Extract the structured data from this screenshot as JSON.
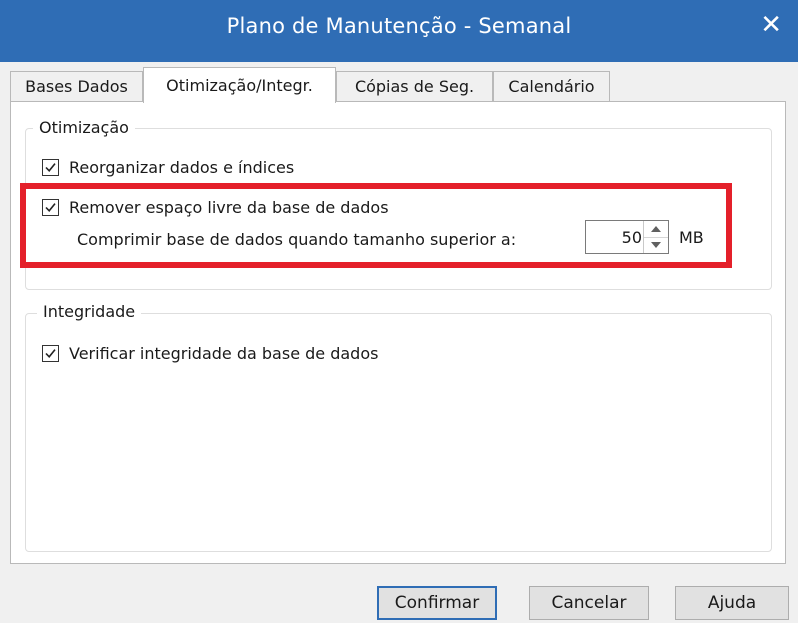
{
  "window": {
    "title": "Plano de Manutenção - Semanal",
    "close_glyph": "✕"
  },
  "tabs": [
    {
      "label": "Bases Dados",
      "active": false
    },
    {
      "label": "Otimização/Integr.",
      "active": true
    },
    {
      "label": "Cópias de Seg.",
      "active": false
    },
    {
      "label": "Calendário",
      "active": false
    }
  ],
  "optimization": {
    "legend": "Otimização",
    "reorganize": {
      "label": "Reorganizar dados e índices",
      "checked": true
    },
    "remove_free_space": {
      "label": "Remover espaço livre da base de dados",
      "checked": true
    },
    "compress": {
      "label": "Comprimir base de dados quando tamanho superior a:",
      "value": "50",
      "unit": "MB"
    }
  },
  "integrity": {
    "legend": "Integridade",
    "verify": {
      "label": "Verificar integridade da base de dados",
      "checked": true
    }
  },
  "buttons": {
    "confirm": "Confirmar",
    "cancel": "Cancelar",
    "help": "Ajuda"
  },
  "colors": {
    "titlebar": "#2f6db5",
    "highlight": "#e4202a"
  }
}
